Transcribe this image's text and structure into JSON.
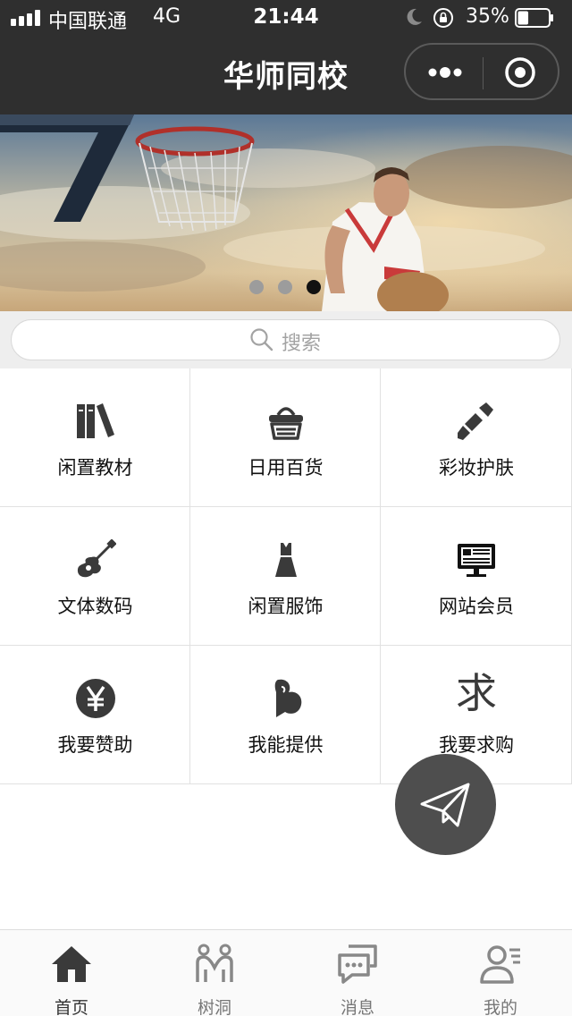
{
  "status_bar": {
    "carrier": "中国联通",
    "network": "4G",
    "time": "21:44",
    "battery_percent": "35%",
    "battery_level": 0.35
  },
  "header": {
    "title": "华师同校",
    "more_icon": "more-dots-icon",
    "close_icon": "target-close-icon"
  },
  "banner": {
    "slide_count": 3,
    "active_slide": 3
  },
  "search": {
    "placeholder": "搜索",
    "icon": "search-icon"
  },
  "categories": [
    {
      "label": "闲置教材",
      "icon": "books-icon"
    },
    {
      "label": "日用百货",
      "icon": "shopping-basket-icon"
    },
    {
      "label": "彩妆护肤",
      "icon": "lipstick-icon"
    },
    {
      "label": "文体数码",
      "icon": "guitar-icon"
    },
    {
      "label": "闲置服饰",
      "icon": "dress-icon"
    },
    {
      "label": "网站会员",
      "icon": "monitor-icon"
    },
    {
      "label": "我要赞助",
      "icon": "yen-coin-icon"
    },
    {
      "label": "我能提供",
      "icon": "muscle-arm-icon"
    },
    {
      "label": "我要求购",
      "icon": "qiu-char-icon",
      "glyph": "求"
    }
  ],
  "fab": {
    "icon": "paper-plane-icon"
  },
  "tabbar": {
    "tabs": [
      {
        "label": "首页",
        "icon": "home-icon",
        "active": true
      },
      {
        "label": "树洞",
        "icon": "people-icon",
        "active": false
      },
      {
        "label": "消息",
        "icon": "chat-icon",
        "active": false
      },
      {
        "label": "我的",
        "icon": "profile-icon",
        "active": false
      }
    ]
  },
  "colors": {
    "header_bg": "#2f2f2f",
    "icon_dark": "#3a3a3a",
    "tab_inactive": "#777777",
    "fab_bg": "#4e4e4e"
  }
}
